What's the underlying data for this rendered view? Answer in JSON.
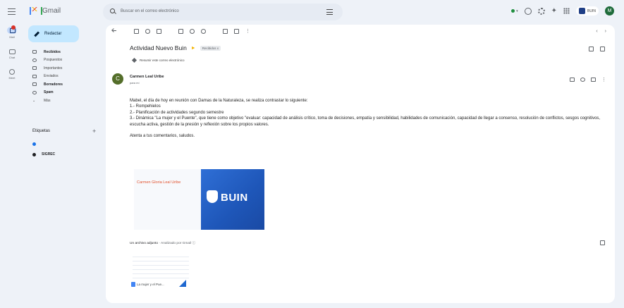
{
  "app": {
    "name": "Gmail"
  },
  "rail": {
    "items": [
      {
        "label": "Mail"
      },
      {
        "label": "Chat"
      },
      {
        "label": "Meet"
      }
    ]
  },
  "search": {
    "placeholder": "Buscar en el correo electrónico"
  },
  "topbar": {
    "status_label": "",
    "org_label": "BUIN",
    "avatar_letter": "M"
  },
  "sidebar": {
    "compose_label": "Redactar",
    "items": [
      {
        "label": "Recibidos",
        "count": "",
        "bold": true
      },
      {
        "label": "Pospuestos",
        "count": ""
      },
      {
        "label": "Importantes",
        "count": ""
      },
      {
        "label": "Enviados",
        "count": ""
      },
      {
        "label": "Borradores",
        "count": "",
        "bold": true
      },
      {
        "label": "Spam",
        "count": "",
        "bold": true
      },
      {
        "label": "Más",
        "count": ""
      }
    ],
    "labels_title": "Etiquetas",
    "labels": [
      {
        "name": "",
        "color": "#1a73e8"
      },
      {
        "name": "SIGREC",
        "color": "#202124",
        "bold": true
      }
    ]
  },
  "message": {
    "subject": "Actividad Nuevo Buin",
    "chip": "Recibidos x",
    "summary": "Resumir este correo electrónico",
    "sender_initial": "C",
    "sender_name": "Carmen Leal Uribe",
    "to_line": "para mí",
    "date": "",
    "body": [
      "Mabel, el día de hoy en reunión con Damas de la Naturaleza, se realiza contrastar lo siguiente:",
      "1.- Rompehielos",
      "2.- Planificación de actividades segundo semestre",
      "3.- Dinámica \"La mujer y el Puente\", que tiene como objetivo \"evaluar: capacidad de análisis crítico, toma de decisiones, empatía y sensibilidad, habilidades de comunicación, capacidad de llegar a consenso, resolución de conflictos, sesgos cognitivos, escucha activa, gestión de la presión y reflexión sobre los propios valores.",
      "",
      "Atenta a tus comentarios, saludos."
    ],
    "signature": {
      "name": "Carmen Gloria Leal Uribe",
      "lines": [
        "",
        "",
        "",
        "",
        "",
        "",
        ""
      ],
      "brand": "BUIN"
    },
    "attachments_title": "Un archivo adjunto",
    "attachments_scan": "· Analizado por Gmail ⓘ",
    "attachment_name": "La mujer y el Pue..."
  }
}
